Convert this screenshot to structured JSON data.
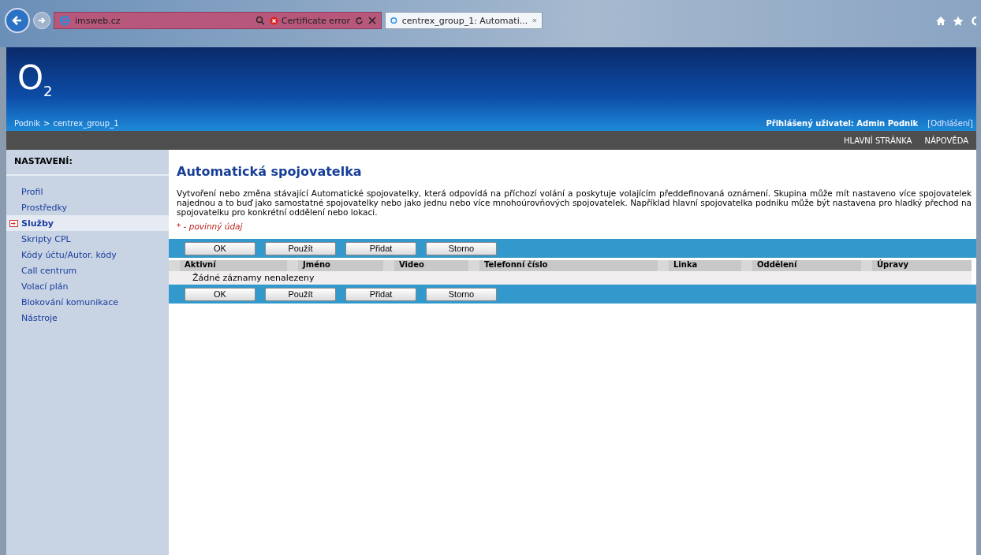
{
  "browser": {
    "address": "imsweb.cz",
    "certificate": "Certificate error",
    "tabs": [
      {
        "label": "centrex_group_1: Automati...",
        "selected": true
      }
    ]
  },
  "header": {
    "logo": "O",
    "logo_sub": "2",
    "breadcrumb": [
      {
        "label": "Podnik"
      },
      {
        "label": "centrex_group_1"
      }
    ],
    "breadcrumb_sep": ">",
    "user": "Přihlášený uživatel: Admin Podnik",
    "logout": "[Odhlášení]"
  },
  "topnav": [
    {
      "label": "HLAVNÍ STRÁNKA"
    },
    {
      "label": "NÁPOVĚDA"
    }
  ],
  "sidebar": {
    "title": "NASTAVENÍ:",
    "items": [
      {
        "label": "Profil",
        "selected": false
      },
      {
        "label": "Prostředky",
        "selected": false
      },
      {
        "label": "Služby",
        "selected": true
      },
      {
        "label": "Skripty CPL",
        "selected": false
      },
      {
        "label": "Kódy účtu/Autor. kódy",
        "selected": false
      },
      {
        "label": "Call centrum",
        "selected": false
      },
      {
        "label": "Volací plán",
        "selected": false
      },
      {
        "label": "Blokování komunikace",
        "selected": false
      },
      {
        "label": "Nástroje",
        "selected": false
      }
    ]
  },
  "page": {
    "title": "Automatická spojovatelka",
    "description": "Vytvoření nebo změna stávající Automatické spojovatelky, která odpovídá na příchozí volání a poskytuje volajícím předdefinovaná oznámení. Skupina může mít nastaveno více spojovatelek najednou a to buď jako samostatné spojovatelky nebo jako jednu nebo více mnohoúrovňových spojovatelek. Například hlavní spojovatelka podniku může být nastavena pro hladký přechod na spojovatelku pro konkrétní oddělení nebo lokaci.",
    "required_note": "* - povinný údaj"
  },
  "buttons_top": [
    "OK",
    "Použít",
    "Přidat",
    "Storno"
  ],
  "table": {
    "columns": [
      "Aktivní",
      "Jméno",
      "Video",
      "Telefonní číslo",
      "Linka",
      "Oddělení",
      "Úpravy"
    ],
    "empty": "Žádné záznamy nenalezeny"
  },
  "buttons_bottom": [
    "OK",
    "Použít",
    "Přidat",
    "Storno"
  ]
}
